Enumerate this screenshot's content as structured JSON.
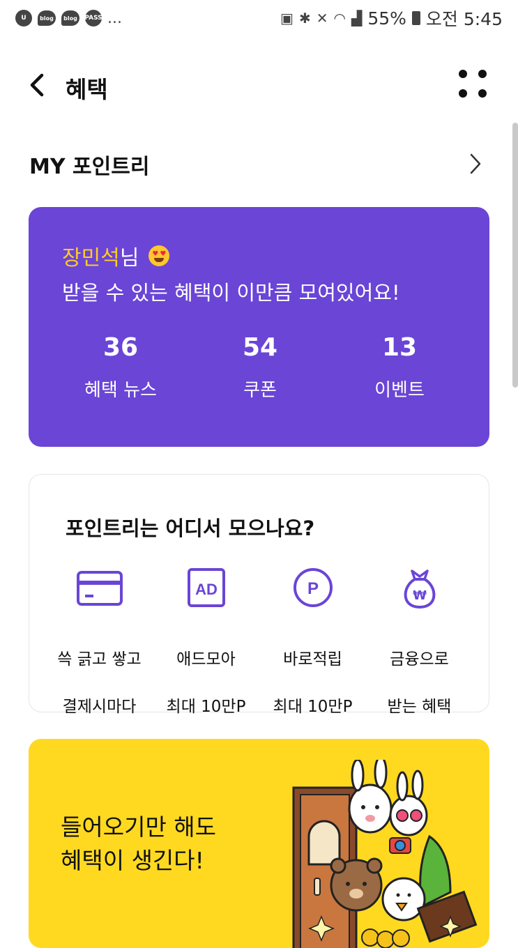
{
  "status_bar": {
    "app_icons": [
      "blog",
      "blog",
      "PASS"
    ],
    "more": "...",
    "battery": "55%",
    "time": "오전 5:45"
  },
  "header": {
    "title": "혜택"
  },
  "section": {
    "title": "MY 포인트리"
  },
  "summary_card": {
    "user_name": "장민석",
    "honorific": "님",
    "subtitle": "받을 수 있는 혜택이 이만큼 모여있어요!",
    "stats": [
      {
        "value": "36",
        "label": "혜택 뉴스"
      },
      {
        "value": "54",
        "label": "쿠폰"
      },
      {
        "value": "13",
        "label": "이벤트"
      }
    ]
  },
  "sources_card": {
    "title": "포인트리는 어디서 모으나요?",
    "items": [
      {
        "icon": "card-icon",
        "line1": "쓱 긁고 쌓고",
        "line2": "결제시마다"
      },
      {
        "icon": "ad-icon",
        "icon_text": "AD",
        "line1": "애드모아",
        "line2": "최대 10만P"
      },
      {
        "icon": "point-coin-icon",
        "icon_text": "P",
        "line1": "바로적립",
        "line2": "최대 10만P"
      },
      {
        "icon": "money-bag-icon",
        "icon_text": "₩",
        "line1": "금융으로",
        "line2": "받는 혜택"
      }
    ]
  },
  "banner": {
    "line1": "들어오기만 해도",
    "line2": "혜택이 생긴다!"
  },
  "colors": {
    "accent_purple": "#6a45d6",
    "name_yellow": "#ffcc24",
    "banner_yellow": "#ffd920"
  }
}
